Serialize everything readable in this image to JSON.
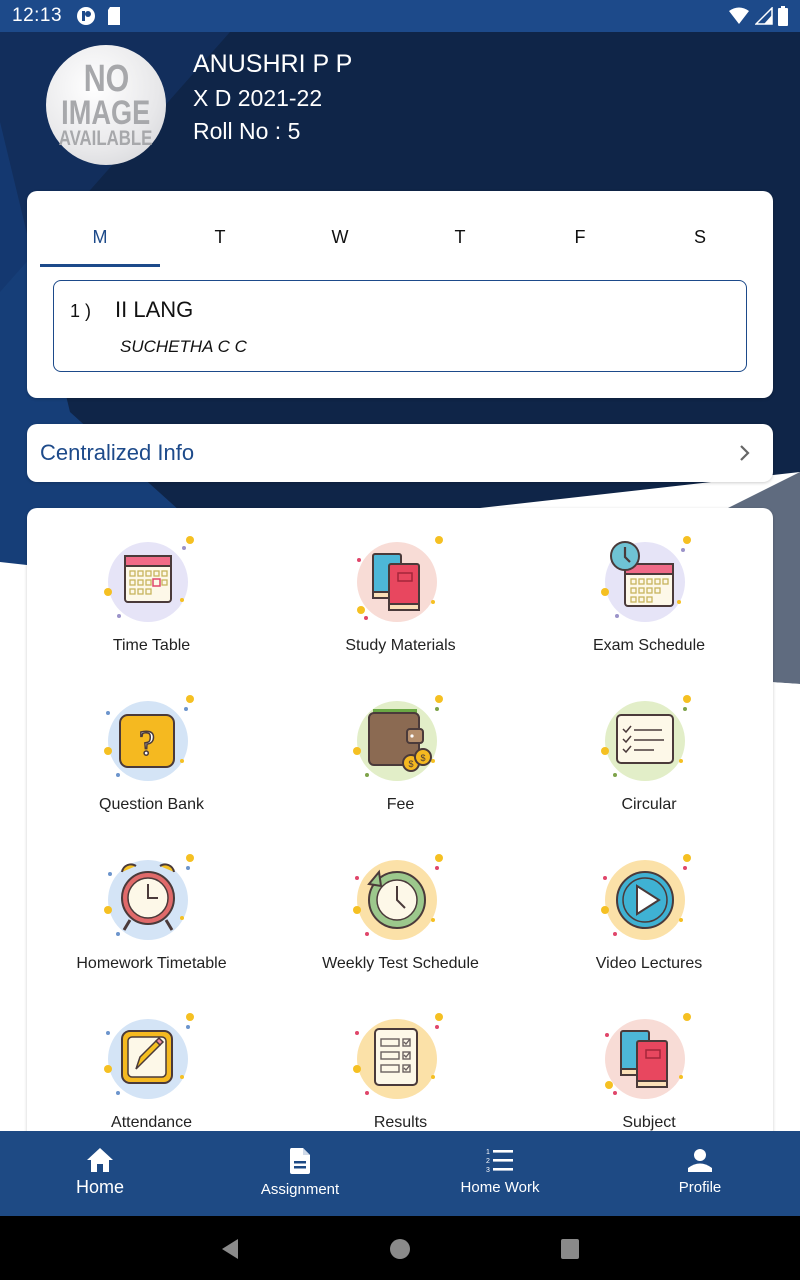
{
  "status_bar": {
    "time": "12:13",
    "left_icons": [
      "app-notification-icon",
      "sd-card-icon"
    ],
    "right_icons": [
      "wifi-icon",
      "cell-signal-icon",
      "battery-icon"
    ]
  },
  "profile": {
    "avatar_placeholder": [
      "NO",
      "IMAGE",
      "AVAILABLE"
    ],
    "name": "ANUSHRI P P",
    "class_year": "X D 2021-22",
    "roll": "Roll No : 5"
  },
  "timetable": {
    "days": [
      "M",
      "T",
      "W",
      "T",
      "F",
      "S"
    ],
    "active_day_index": 0,
    "periods": [
      {
        "number": "1 )",
        "subject": "II LANG",
        "teacher": "SUCHETHA C C"
      }
    ]
  },
  "centralized_info": {
    "label": "Centralized Info"
  },
  "menu": {
    "items": [
      {
        "label": "Time Table",
        "icon": "calendar-icon"
      },
      {
        "label": "Study Materials",
        "icon": "books-icon"
      },
      {
        "label": "Exam Schedule",
        "icon": "calendar-clock-icon"
      },
      {
        "label": "Question Bank",
        "icon": "question-icon"
      },
      {
        "label": "Fee",
        "icon": "wallet-icon"
      },
      {
        "label": "Circular",
        "icon": "checklist-icon"
      },
      {
        "label": "Homework Timetable",
        "icon": "alarm-clock-icon"
      },
      {
        "label": "Weekly Test Schedule",
        "icon": "clock-refresh-icon"
      },
      {
        "label": "Video Lectures",
        "icon": "play-icon"
      },
      {
        "label": "Attendance",
        "icon": "pencil-icon"
      },
      {
        "label": "Results",
        "icon": "results-sheet-icon"
      },
      {
        "label": "Subject",
        "icon": "books-icon"
      }
    ]
  },
  "bottom_nav": {
    "items": [
      {
        "label": "Home",
        "icon": "home-icon",
        "active": true
      },
      {
        "label": "Assignment",
        "icon": "document-icon",
        "active": false
      },
      {
        "label": "Home Work",
        "icon": "numbered-list-icon",
        "active": false
      },
      {
        "label": "Profile",
        "icon": "person-icon",
        "active": false
      }
    ]
  },
  "colors": {
    "primary": "#1d4a8a",
    "header_dark": "#0f2548",
    "nav_bar": "#1e4a84"
  }
}
